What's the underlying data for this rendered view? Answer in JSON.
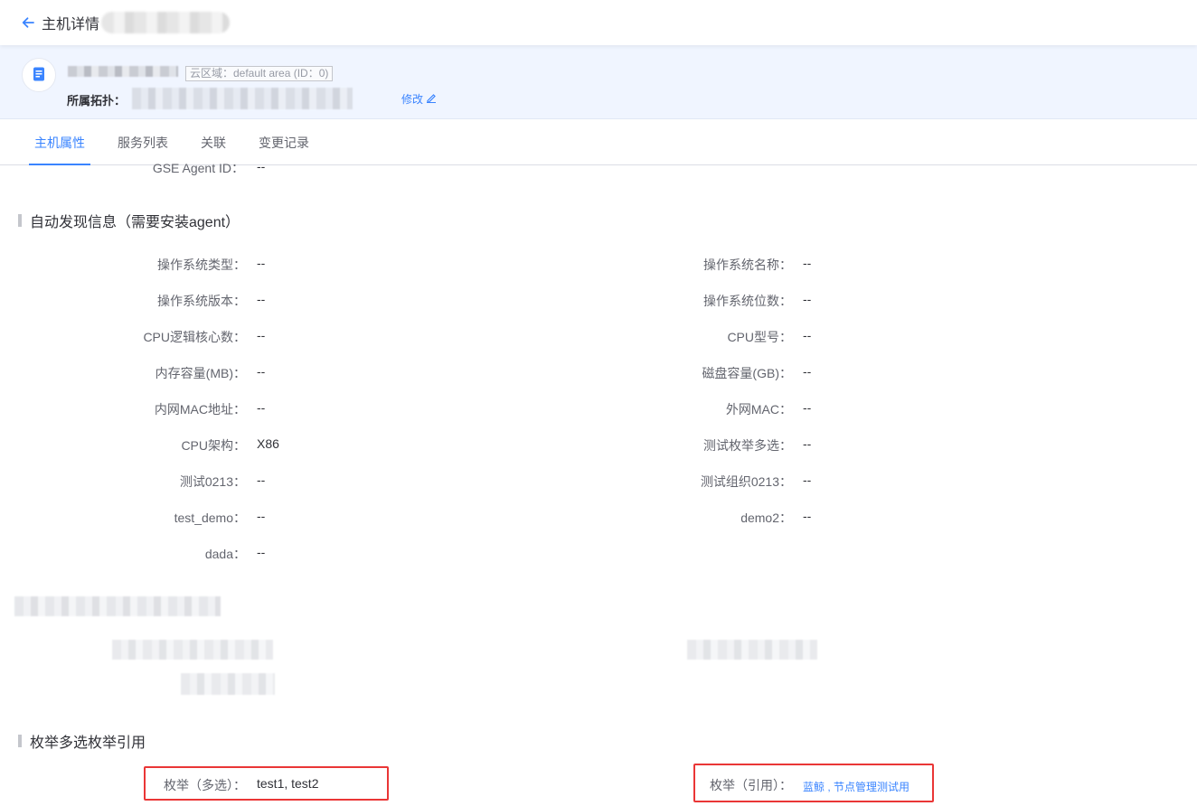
{
  "topbar": {
    "title": "主机详情"
  },
  "header": {
    "cloud_area_tag": "云区域：default area (ID：0)",
    "topology_label": "所属拓扑：",
    "edit_label": "修改"
  },
  "tabs": [
    {
      "label": "主机属性",
      "active": true
    },
    {
      "label": "服务列表",
      "active": false
    },
    {
      "label": "关联",
      "active": false
    },
    {
      "label": "变更记录",
      "active": false
    }
  ],
  "partial_field": {
    "label": "GSE Agent ID：",
    "value": "--"
  },
  "auto_discovery": {
    "title": "自动发现信息（需要安装agent）",
    "left_fields": [
      {
        "label": "操作系统类型：",
        "value": "--"
      },
      {
        "label": "操作系统版本：",
        "value": "--"
      },
      {
        "label": "CPU逻辑核心数：",
        "value": "--"
      },
      {
        "label": "内存容量(MB)：",
        "value": "--"
      },
      {
        "label": "内网MAC地址：",
        "value": "--"
      },
      {
        "label": "CPU架构：",
        "value": "X86"
      },
      {
        "label": "测试0213：",
        "value": "--"
      },
      {
        "label": "test_demo：",
        "value": "--"
      },
      {
        "label": "dada：",
        "value": "--"
      }
    ],
    "right_fields": [
      {
        "label": "操作系统名称：",
        "value": "--"
      },
      {
        "label": "操作系统位数：",
        "value": "--"
      },
      {
        "label": "CPU型号：",
        "value": "--"
      },
      {
        "label": "磁盘容量(GB)：",
        "value": "--"
      },
      {
        "label": "外网MAC：",
        "value": "--"
      },
      {
        "label": "测试枚举多选：",
        "value": "--"
      },
      {
        "label": "测试组织0213：",
        "value": "--"
      },
      {
        "label": "demo2：",
        "value": "--"
      }
    ]
  },
  "enum_section": {
    "title": "枚举多选枚举引用",
    "multi_label": "枚举（多选）：",
    "multi_value": "test1, test2",
    "ref_label": "枚举（引用）：",
    "ref_value": "蓝鲸 , 节点管理测试用"
  },
  "colors": {
    "accent": "#3a84ff",
    "highlight": "#ea3636",
    "header_bg": "#f0f5ff"
  },
  "icons": {
    "back": "arrow-left-icon",
    "host": "host-document-icon",
    "edit": "pencil-icon"
  }
}
